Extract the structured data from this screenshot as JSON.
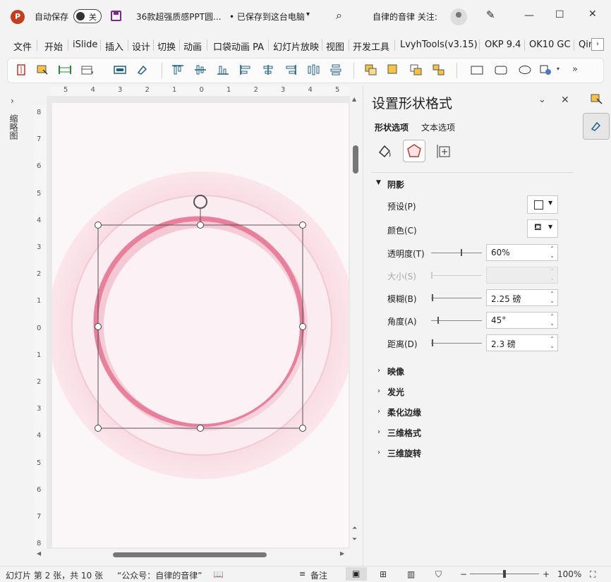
{
  "titlebar": {
    "autosave_label": "自动保存",
    "autosave_state": "关",
    "doc_title": "36款超强质感PPT圆...",
    "save_status": "• 已保存到这台电脑",
    "user_label": "自律的音律 关注:"
  },
  "tabs": [
    "文件",
    "开始",
    "iSlide",
    "插入",
    "设计",
    "切换",
    "动画",
    "口袋动画 PA",
    "幻灯片放映",
    "视图",
    "开发工具",
    "LvyhTools(v3.15)",
    "OKP 9.4",
    "OK10 GC",
    "Qin"
  ],
  "left_panel": {
    "label": "缩略图"
  },
  "rulers": {
    "horizontal": [
      "5",
      "4",
      "3",
      "2",
      "1",
      "0",
      "1",
      "2",
      "3",
      "4",
      "5"
    ],
    "vertical": [
      "8",
      "7",
      "6",
      "5",
      "4",
      "3",
      "2",
      "1",
      "0",
      "1",
      "2",
      "3",
      "4",
      "5",
      "6",
      "7",
      "8"
    ]
  },
  "pane": {
    "title": "设置形状格式",
    "subtabs": [
      "形状选项",
      "文本选项"
    ],
    "shadow_section": "阴影",
    "preset_label": "预设(P)",
    "color_label": "颜色(C)",
    "transparency_label": "透明度(T)",
    "transparency_value": "60%",
    "transparency_fraction": 0.6,
    "size_label": "大小(S)",
    "blur_label": "模糊(B)",
    "blur_value": "2.25 磅",
    "angle_label": "角度(A)",
    "angle_value": "45°",
    "distance_label": "距离(D)",
    "distance_value": "2.3 磅",
    "collapsed_sections": [
      "映像",
      "发光",
      "柔化边缘",
      "三维格式",
      "三维旋转"
    ]
  },
  "status": {
    "slide_info": "幻灯片 第 2 张，共 10 张",
    "public_account": "“公众号：自律的音律”",
    "notes_label": "备注",
    "zoom": "100%"
  },
  "colors": {
    "ring": "#e8809c",
    "accent_purple": "#7a2a8a",
    "ppt_red": "#c43e1c"
  }
}
